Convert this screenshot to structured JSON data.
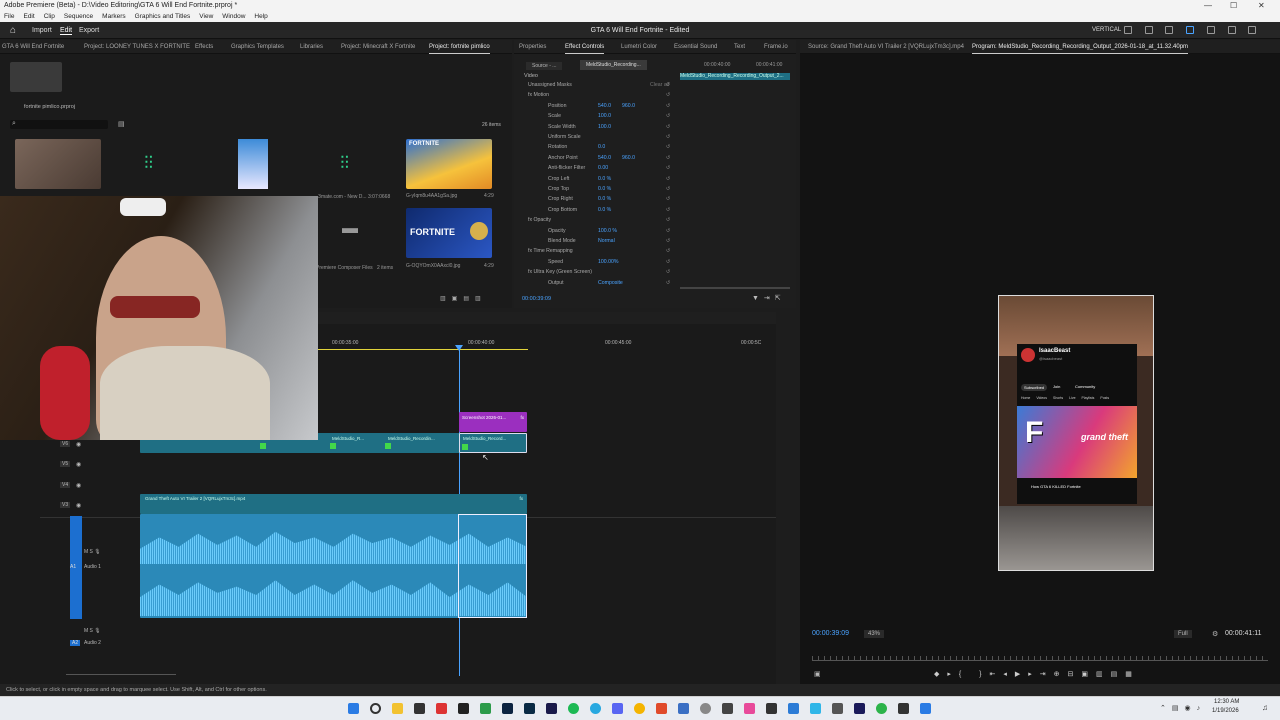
{
  "window": {
    "title": "Adobe Premiere (Beta) - D:\\Video Editoring\\GTA 6 Will End Fortnite.prproj *",
    "min": "—",
    "max": "☐",
    "close": "✕"
  },
  "menu": [
    "File",
    "Edit",
    "Clip",
    "Sequence",
    "Markers",
    "Graphics and Titles",
    "View",
    "Window",
    "Help"
  ],
  "header": {
    "home": "⌂",
    "import": "Import",
    "edit": "Edit",
    "export": "Export",
    "title": "GTA 6 Will End Fortnite - Edited",
    "workspace": "VERTICAL"
  },
  "project": {
    "tabs": [
      "GTA 6 Will End Fortnite",
      "Project: LOONEY TUNES X FORTNITE",
      "Effects",
      "Graphics Templates",
      "Libraries",
      "Project: Minecraft X Fortnite",
      "Project: fortnite pimlico"
    ],
    "bin_name": "fortnite pimlico.prproj",
    "items_count": "26 items",
    "items": [
      {
        "name": "",
        "meta": "",
        "color": "#6b5a4e"
      },
      {
        "name": "",
        "meta": "",
        "color": "#1a1a1a"
      },
      {
        "name": "",
        "meta": "",
        "color": "#2a6fb5"
      },
      {
        "name": "",
        "meta": "",
        "color": "#1a1a1a"
      },
      {
        "name": "G-yIqm8u4AA1gSa.jpg",
        "meta": "4:29",
        "color": "#f0b530"
      },
      {
        "name": "",
        "meta": "",
        "color": "#2a2a2a"
      },
      {
        "name": "...3mate.com - New D...",
        "meta": "3:07:0668",
        "color": "#2a2a2a"
      },
      {
        "name": "Premiere Composer Files",
        "meta": "2 items",
        "color": "#2a2a2a"
      },
      {
        "name": "G-OQYOmX0AAxcl0.jpg",
        "meta": "4:29",
        "color": "#1a3c8a"
      }
    ]
  },
  "effect_controls": {
    "tabs": [
      "Properties",
      "Effect Controls",
      "Lumetri Color",
      "Essential Sound",
      "Text",
      "Frame.io"
    ],
    "source": "Source - ...",
    "clip": "MeldStudio_Recording...",
    "section": "Video",
    "mini_clip": "MeldStudio_Recording_Recording_Output_2...",
    "rows": [
      {
        "label": "Unassigned Masks",
        "v1": "",
        "v2": "",
        "extra": "Clear all"
      },
      {
        "label": "fx  Motion",
        "v1": "",
        "v2": ""
      },
      {
        "label": "Position",
        "v1": "540.0",
        "v2": "960.0"
      },
      {
        "label": "Scale",
        "v1": "100.0",
        "v2": ""
      },
      {
        "label": "Scale Width",
        "v1": "100.0",
        "v2": ""
      },
      {
        "label": "Uniform Scale",
        "v1": "",
        "v2": ""
      },
      {
        "label": "Rotation",
        "v1": "0.0",
        "v2": ""
      },
      {
        "label": "Anchor Point",
        "v1": "540.0",
        "v2": "960.0"
      },
      {
        "label": "Anti-flicker Filter",
        "v1": "0.00",
        "v2": ""
      },
      {
        "label": "Crop Left",
        "v1": "0.0 %",
        "v2": ""
      },
      {
        "label": "Crop Top",
        "v1": "0.0 %",
        "v2": ""
      },
      {
        "label": "Crop Right",
        "v1": "0.0 %",
        "v2": ""
      },
      {
        "label": "Crop Bottom",
        "v1": "0.0 %",
        "v2": ""
      },
      {
        "label": "fx  Opacity",
        "v1": "",
        "v2": ""
      },
      {
        "label": "Opacity",
        "v1": "100.0 %",
        "v2": ""
      },
      {
        "label": "Blend Mode",
        "v1": "Normal",
        "v2": ""
      },
      {
        "label": "fx  Time Remapping",
        "v1": "",
        "v2": ""
      },
      {
        "label": "Speed",
        "v1": "100.00%",
        "v2": ""
      },
      {
        "label": "fx  Ultra Key (Green Screen)",
        "v1": "",
        "v2": ""
      },
      {
        "label": "Output",
        "v1": "Composite",
        "v2": ""
      }
    ],
    "time_ruler": [
      "00:00:40:00",
      "00:00:41:00"
    ],
    "timecode": "00:00:39:09"
  },
  "source_tab": "Source: Grand Theft Auto VI Trailer 2 [VQRLujxTm3c].mp4",
  "program": {
    "tab": "Program: MeldStudio_Recording_Recording_Output_2026-01-18_at_11.32.40pm",
    "timecode": "00:00:39:09",
    "zoom": "43%",
    "quality": "Full",
    "duration": "00:00:41:11",
    "yt": {
      "channel": "IsaacBeast",
      "handle": "@isaacbeast",
      "tabs": [
        "Home",
        "Videos",
        "Shorts",
        "Live",
        "Playlists",
        "Posts"
      ],
      "video_title": "How GTA 6 KILLED Fortnite",
      "subscribe": "Subscribed",
      "join": "Join",
      "community": "Community",
      "logo_letter": "F",
      "gta": "grand theft"
    }
  },
  "timeline": {
    "ruler": [
      "00:00:35:00",
      "00:00:40:00",
      "00:00:45:00",
      "00:00:5C"
    ],
    "tracks": [
      "V6",
      "V5",
      "V4",
      "V3",
      "A1",
      "A2"
    ],
    "a1_label": "Audio 1",
    "a2_label": "Audio 2",
    "clips": {
      "screenshot": "Screenshot 2026-01...",
      "meld1": "MeldStudio_R...",
      "meld2": "MeldStudio_Recordin...",
      "meld3": "MeldStudio_Record...",
      "gta": "Grand Theft Auto VI Trailer 2 [VQRLujxTm3c].mp4"
    },
    "fx": "fx"
  },
  "status": "Click to select, or click in empty space and drag to marquee select. Use Shift, Alt, and Ctrl for other options.",
  "taskbar": {
    "time": "12:30 AM",
    "date": "1/19/2026"
  },
  "colors": {
    "accent": "#2d8ceb",
    "clip_teal": "#1f6f84",
    "clip_purple": "#9b2fbf",
    "audio": "#4fb8ea"
  }
}
